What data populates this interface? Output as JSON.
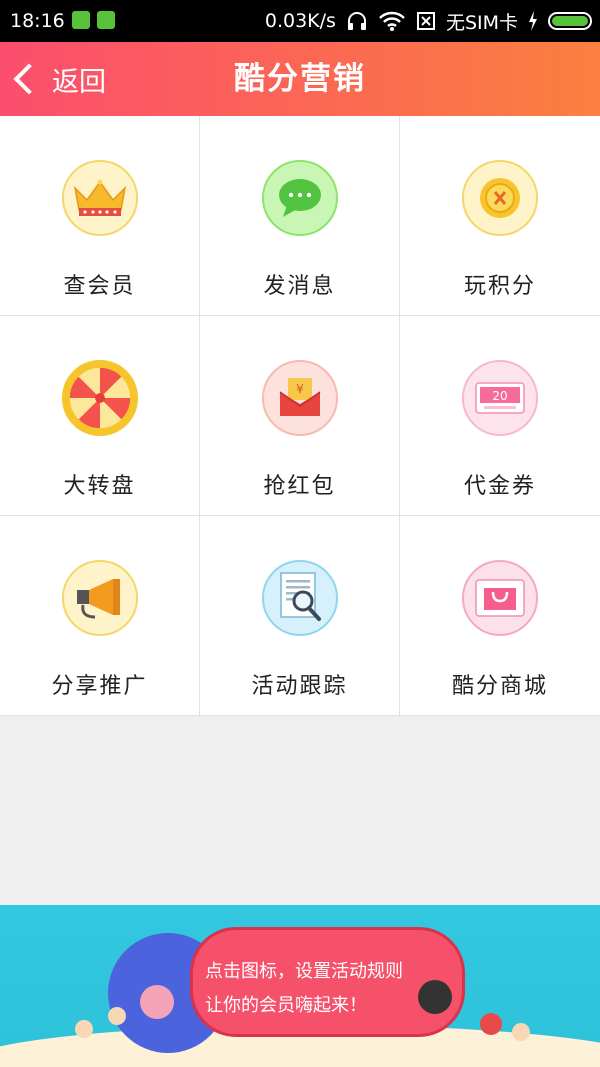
{
  "status_bar": {
    "time": "18:16",
    "network_speed": "0.03K/s",
    "sim_status": "无SIM卡"
  },
  "header": {
    "back_label": "返回",
    "title": "酷分营销"
  },
  "grid": {
    "items": [
      {
        "label": "查会员",
        "icon": "crown-icon"
      },
      {
        "label": "发消息",
        "icon": "chat-bubble-icon"
      },
      {
        "label": "玩积分",
        "icon": "coin-icon"
      },
      {
        "label": "大转盘",
        "icon": "spin-wheel-icon"
      },
      {
        "label": "抢红包",
        "icon": "red-envelope-icon"
      },
      {
        "label": "代金券",
        "icon": "voucher-icon"
      },
      {
        "label": "分享推广",
        "icon": "megaphone-icon"
      },
      {
        "label": "活动跟踪",
        "icon": "document-search-icon"
      },
      {
        "label": "酷分商城",
        "icon": "shopping-bag-icon"
      }
    ]
  },
  "voucher_value": "20",
  "coin_symbol": "¥",
  "banner": {
    "line1": "点击图标，设置活动规则",
    "line2": "让你的会员嗨起来！"
  },
  "colors": {
    "header_gradient_start": "#fb4e6e",
    "header_gradient_end": "#fb8040",
    "banner_bg": "#33c8e0"
  }
}
